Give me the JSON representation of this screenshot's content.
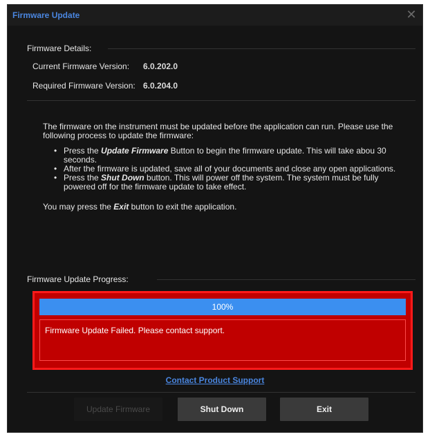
{
  "window": {
    "title": "Firmware Update",
    "close_glyph": "✕"
  },
  "details": {
    "heading": "Firmware Details:",
    "current_label": "Current Firmware Version:",
    "current_value": "6.0.202.0",
    "required_label": "Required Firmware Version:",
    "required_value": "6.0.204.0"
  },
  "instructions": {
    "intro": "The firmware on the instrument must be updated before the application can run. Please use the following process to update the firmware:",
    "bullet_glyph": "•",
    "step1_pre": "Press the ",
    "step1_em": "Update Firmware",
    "step1_post": " Button to begin the firmware update.  This will take abou 30 seconds.",
    "step2": "After the firmware is updated, save all of your documents and close any open applications.",
    "step3_pre": "Press the ",
    "step3_em": "Shut Down",
    "step3_post": " button.  This will power off the system.  The system must be fully powered off for the firmware update to take effect.",
    "exit_pre": "You may press the ",
    "exit_em": "Exit",
    "exit_post": " button to exit the application."
  },
  "progress": {
    "heading": "Firmware Update Progress:",
    "percent_text": "100%",
    "value": 1.0,
    "error_message": "Firmware Update Failed. Please contact support."
  },
  "support_link": "Contact Product Support",
  "buttons": {
    "update": "Update Firmware",
    "shutdown": "Shut Down",
    "exit": "Exit"
  },
  "colors": {
    "title_blue": "#4a86e0",
    "progress_blue": "#3b8ff0",
    "error_red": "#c00000",
    "error_border": "#ff1a1a"
  }
}
